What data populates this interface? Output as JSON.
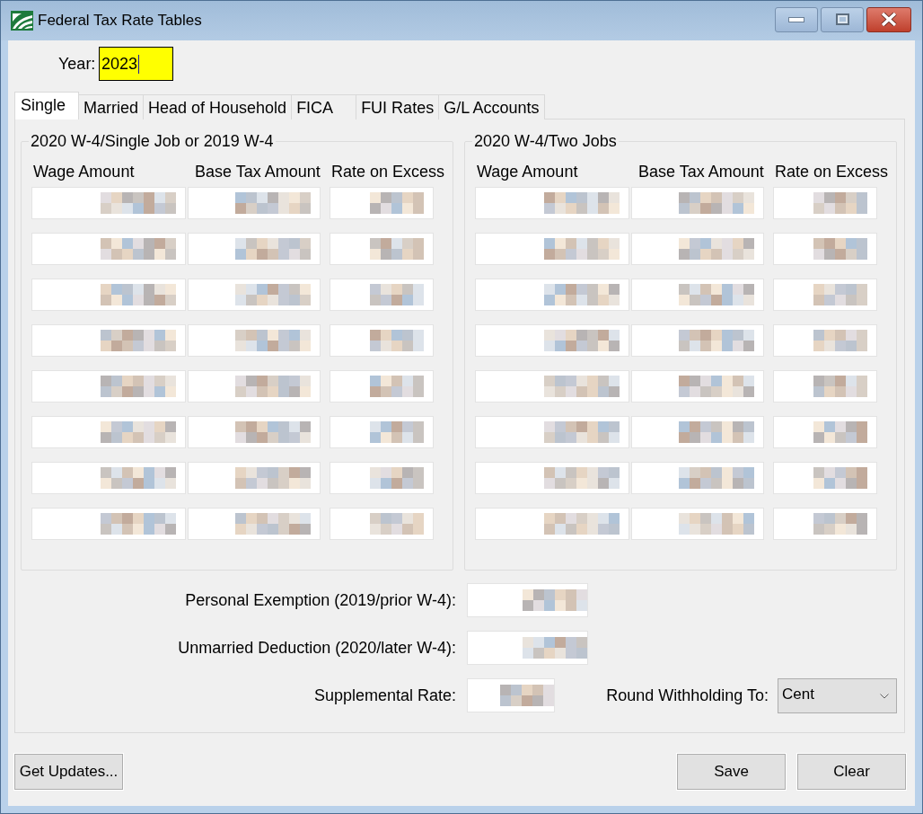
{
  "window": {
    "title": "Federal Tax Rate Tables"
  },
  "year": {
    "label": "Year:",
    "value": "2023",
    "focused": true
  },
  "tabs": [
    {
      "label": "Single",
      "selected": true
    },
    {
      "label": "Married",
      "selected": false
    },
    {
      "label": "Head of Household",
      "selected": false
    },
    {
      "label": "FICA",
      "selected": false
    },
    {
      "label": "FUI Rates",
      "selected": false
    },
    {
      "label": "G/L Accounts",
      "selected": false
    }
  ],
  "groups": [
    {
      "title": "2020 W-4/Single Job or 2019 W-4",
      "columns": [
        "Wage Amount",
        "Base Tax Amount",
        "Rate on Excess"
      ],
      "rows": [
        {
          "redacted": true
        },
        {
          "redacted": true
        },
        {
          "redacted": true
        },
        {
          "redacted": true
        },
        {
          "redacted": true
        },
        {
          "redacted": true
        },
        {
          "redacted": true
        },
        {
          "redacted": true
        }
      ]
    },
    {
      "title": "2020 W-4/Two Jobs",
      "columns": [
        "Wage Amount",
        "Base Tax Amount",
        "Rate on Excess"
      ],
      "rows": [
        {
          "redacted": true
        },
        {
          "redacted": true
        },
        {
          "redacted": true
        },
        {
          "redacted": true
        },
        {
          "redacted": true
        },
        {
          "redacted": true
        },
        {
          "redacted": true
        },
        {
          "redacted": true
        }
      ]
    }
  ],
  "fields": [
    {
      "label": "Personal Exemption (2019/prior W-4):",
      "kind": "amount",
      "redacted": true
    },
    {
      "label": "Unmarried Deduction (2020/later W-4):",
      "kind": "amount",
      "redacted": true
    },
    {
      "label": "Supplemental Rate:",
      "kind": "rate",
      "redacted": true
    }
  ],
  "rounding": {
    "label": "Round Withholding To:",
    "value": "Cent"
  },
  "footer": {
    "left_buttons": [
      "Get Updates..."
    ],
    "right_buttons": [
      "Save",
      "Clear"
    ]
  }
}
